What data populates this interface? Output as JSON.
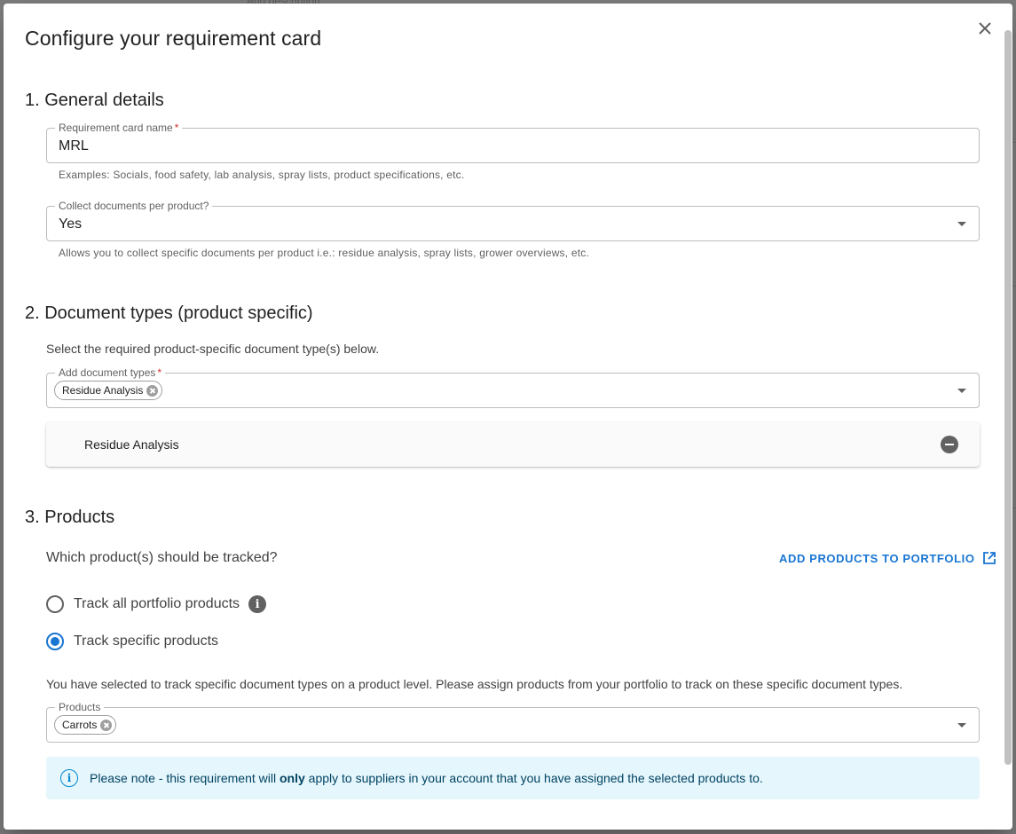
{
  "background": {
    "peek_text": "Add description"
  },
  "dialog": {
    "title": "Configure your requirement card"
  },
  "section1": {
    "title": "1. General details",
    "name_field": {
      "label": "Requirement card name",
      "required_mark": "*",
      "value": "MRL",
      "helper": "Examples: Socials, food safety, lab analysis, spray lists, product specifications, etc."
    },
    "collect_field": {
      "label": "Collect documents per product?",
      "value": "Yes",
      "helper": "Allows you to collect specific documents per product i.e.: residue analysis, spray lists, grower overviews, etc."
    }
  },
  "section2": {
    "title": "2. Document types (product specific)",
    "description": "Select the required product-specific document type(s) below.",
    "doc_types_field": {
      "label": "Add document types",
      "required_mark": "*",
      "chips": [
        "Residue Analysis"
      ]
    },
    "selected_docs": [
      "Residue Analysis"
    ]
  },
  "section3": {
    "title": "3. Products",
    "question": "Which product(s) should be tracked?",
    "add_link": "ADD PRODUCTS TO PORTFOLIO",
    "options": [
      {
        "label": "Track all portfolio products",
        "checked": false,
        "has_info": true
      },
      {
        "label": "Track specific products",
        "checked": true,
        "has_info": false
      }
    ],
    "specific_note": "You have selected to track specific document types on a product level. Please assign products from your portfolio to track on these specific document types.",
    "products_field": {
      "label": "Products",
      "chips": [
        "Carrots"
      ]
    },
    "alert": {
      "prefix": "Please note - this requirement will ",
      "emphasis": "only",
      "suffix": " apply to suppliers in your account that you have assigned the selected products to."
    }
  },
  "colors": {
    "primary": "#1976d2",
    "required": "#d32f2f",
    "alert_bg": "#e5f6fd",
    "alert_text": "#014361"
  }
}
